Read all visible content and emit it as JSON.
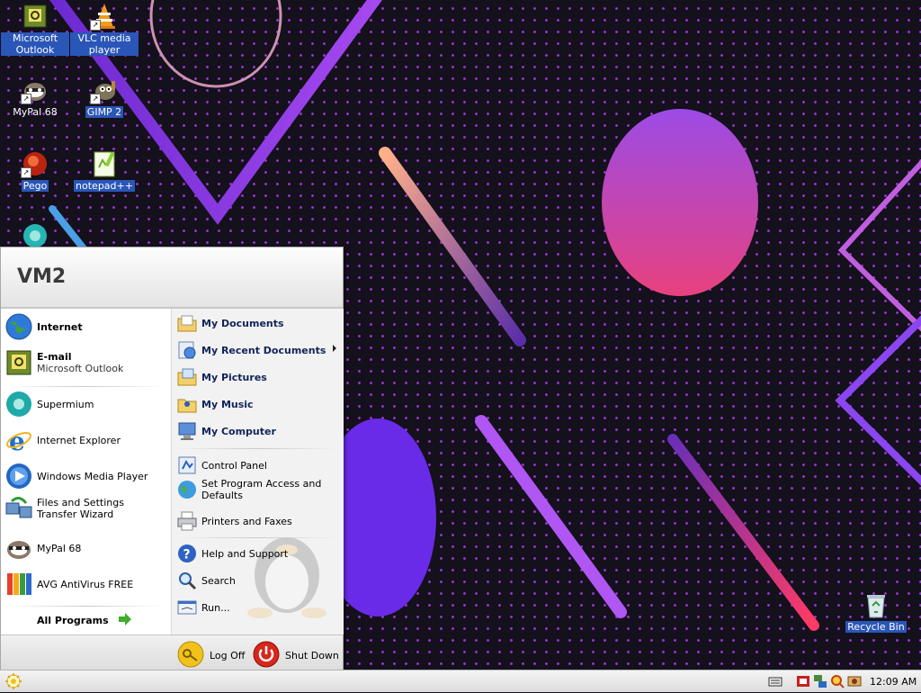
{
  "desktop": {
    "icons": [
      {
        "label": "Microsoft Outlook",
        "icon": "outlook-icon"
      },
      {
        "label": "VLC media player",
        "icon": "vlc-icon"
      },
      {
        "label": "MyPal 68",
        "icon": "mypal-icon"
      },
      {
        "label": "GIMP 2",
        "icon": "gimp-icon"
      },
      {
        "label": "Pego",
        "icon": "pego-icon"
      },
      {
        "label": "notepad++",
        "icon": "notepadpp-icon"
      },
      {
        "label": "Recycle Bin",
        "icon": "recycle-bin-icon"
      }
    ]
  },
  "start_menu": {
    "user": "VM2",
    "pinned": [
      {
        "title": "Internet",
        "subtitle": "",
        "icon": "globe-icon"
      },
      {
        "title": "E-mail",
        "subtitle": "Microsoft Outlook",
        "icon": "outlook-icon"
      }
    ],
    "recent": [
      {
        "label": "Supermium",
        "icon": "supermium-icon"
      },
      {
        "label": "Internet Explorer",
        "icon": "ie-icon"
      },
      {
        "label": "Windows Media Player",
        "icon": "wmp-icon"
      },
      {
        "label": "Files and Settings Transfer Wizard",
        "icon": "transfer-wizard-icon"
      },
      {
        "label": "MyPal 68",
        "icon": "mypal-icon"
      },
      {
        "label": "AVG AntiVirus FREE",
        "icon": "avg-icon"
      }
    ],
    "all_programs": "All Programs",
    "places": [
      {
        "label": "My Documents",
        "icon": "folder-documents-icon"
      },
      {
        "label": "My Recent Documents",
        "icon": "recent-documents-icon",
        "submenu": true
      },
      {
        "label": "My Pictures",
        "icon": "folder-pictures-icon"
      },
      {
        "label": "My Music",
        "icon": "folder-music-icon"
      },
      {
        "label": "My Computer",
        "icon": "computer-icon"
      }
    ],
    "system": [
      {
        "label": "Control Panel",
        "icon": "control-panel-icon"
      },
      {
        "label": "Set Program Access and Defaults",
        "icon": "program-defaults-icon"
      },
      {
        "label": "Printers and Faxes",
        "icon": "printer-icon"
      }
    ],
    "tools": [
      {
        "label": "Help and Support",
        "icon": "help-icon"
      },
      {
        "label": "Search",
        "icon": "search-icon"
      },
      {
        "label": "Run...",
        "icon": "run-icon"
      }
    ],
    "log_off": "Log Off",
    "shut_down": "Shut Down"
  },
  "taskbar": {
    "clock": "12:09 AM",
    "tray_icons": [
      "keyboard-icon",
      "security-icon",
      "network-icon",
      "search-tray-icon",
      "volume-icon"
    ]
  }
}
